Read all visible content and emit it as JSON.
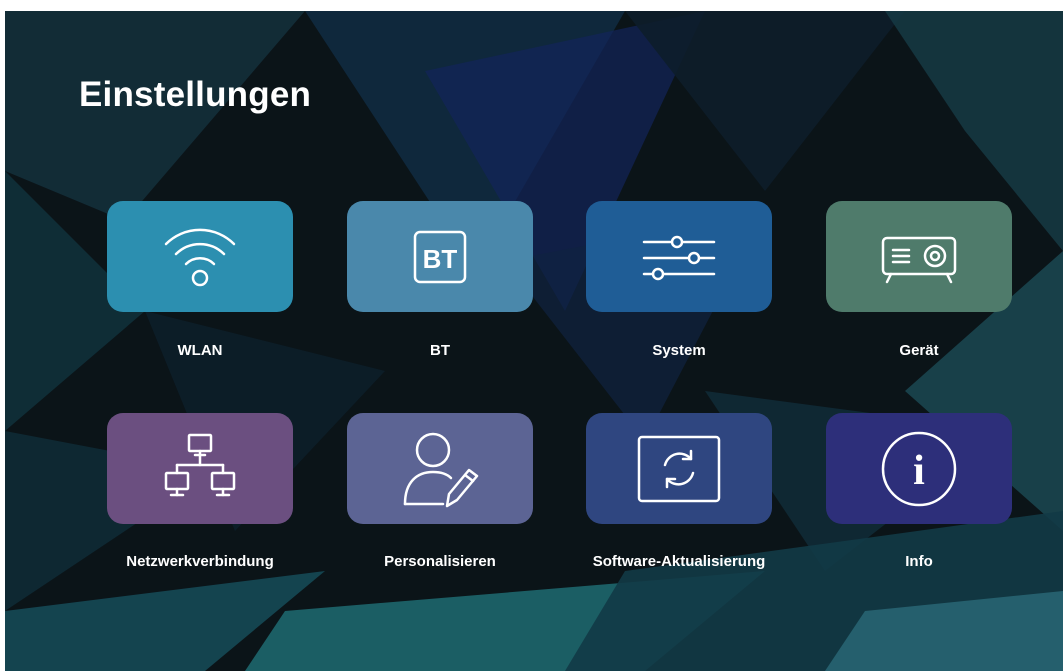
{
  "page": {
    "title": "Einstellungen"
  },
  "tiles": [
    {
      "label": "WLAN",
      "icon": "wifi-icon",
      "color": "#2c8fb0"
    },
    {
      "label": "BT",
      "icon": "bluetooth-icon",
      "color": "#4a88ab"
    },
    {
      "label": "System",
      "icon": "sliders-icon",
      "color": "#1f5d96"
    },
    {
      "label": "Gerät",
      "icon": "projector-icon",
      "color": "#4f7b6b"
    },
    {
      "label": "Netzwerkverbindung",
      "icon": "network-icon",
      "color": "#6b4f80"
    },
    {
      "label": "Personalisieren",
      "icon": "user-edit-icon",
      "color": "#5c6494"
    },
    {
      "label": "Software-Aktualisierung",
      "icon": "refresh-icon",
      "color": "#2f4680"
    },
    {
      "label": "Info",
      "icon": "info-icon",
      "color": "#2d2f7a"
    }
  ],
  "bt_icon_text": "BT",
  "info_icon_text": "i"
}
